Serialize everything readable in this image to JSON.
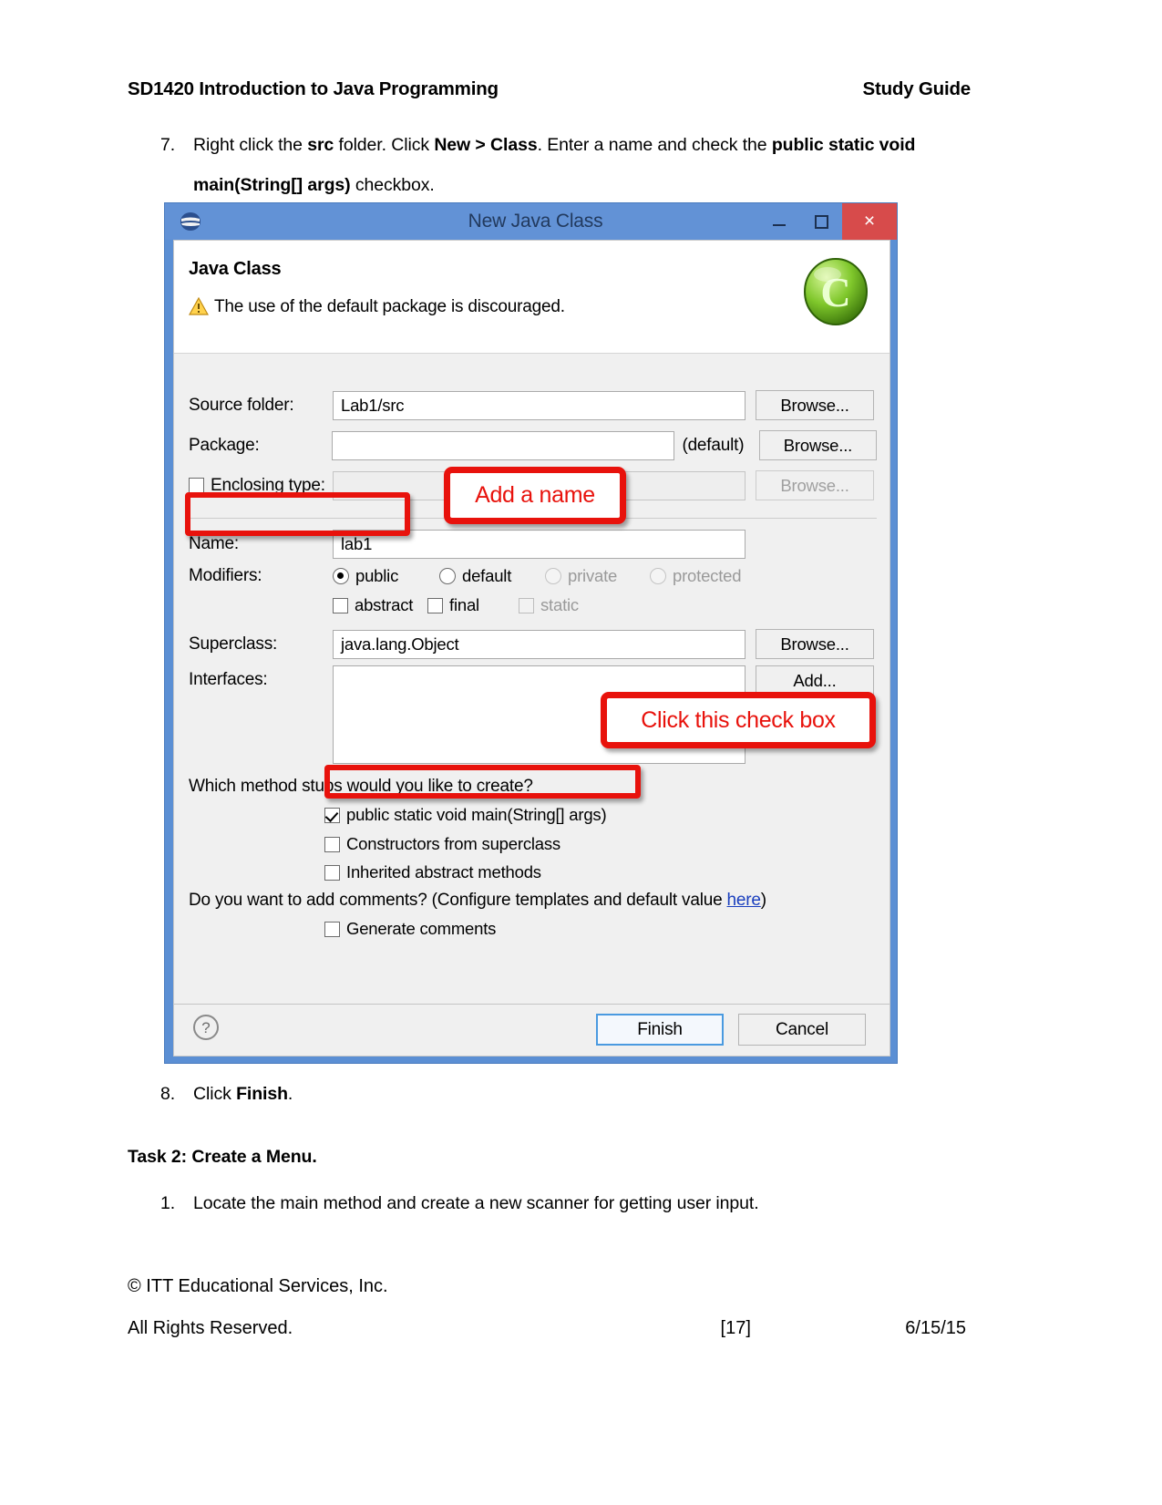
{
  "document": {
    "header_left": "SD1420 Introduction to Java Programming",
    "header_right": "Study Guide",
    "step7": {
      "number": "7.",
      "part1": "Right click the ",
      "bold1": "src",
      "part2": " folder. Click ",
      "bold2": "New > Class",
      "part3": ". Enter a name and check the ",
      "bold3": "public static void main(String[] args)",
      "part4": " checkbox."
    },
    "step8": {
      "number": "8.",
      "part1": "Click ",
      "bold1": "Finish",
      "part2": "."
    },
    "task2_heading": "Task 2: Create a Menu.",
    "task2_step1": {
      "number": "1.",
      "text": "Locate the main method and create a new scanner for getting user input."
    },
    "footer": {
      "copyright": "© ITT Educational Services, Inc.",
      "rights": "All Rights Reserved.",
      "page": "[17]",
      "date": "6/15/15"
    }
  },
  "dialog": {
    "title": "New Java Class",
    "title_icon": "eclipse-icon",
    "window_controls": {
      "minimize": "minimize-icon",
      "maximize": "maximize-icon",
      "close": "×"
    },
    "banner": {
      "heading": "Java Class",
      "message": "The use of the default package is discouraged.",
      "warning_icon": "warning-icon",
      "logo_icon": "java-class-logo-icon"
    },
    "fields": {
      "source_folder_label": "Source folder:",
      "source_folder_value": "Lab1/src",
      "source_folder_browse": "Browse...",
      "package_label": "Package:",
      "package_value": "",
      "package_default_hint": "(default)",
      "package_browse": "Browse...",
      "enclosing_type_label": "Enclosing type:",
      "enclosing_type_value": "",
      "enclosing_type_browse": "Browse...",
      "name_label": "Name:",
      "name_value": "lab1",
      "modifiers_label": "Modifiers:",
      "modifier_public": "public",
      "modifier_default": "default",
      "modifier_private": "private",
      "modifier_protected": "protected",
      "modifier_abstract": "abstract",
      "modifier_final": "final",
      "modifier_static": "static",
      "superclass_label": "Superclass:",
      "superclass_value": "java.lang.Object",
      "superclass_browse": "Browse...",
      "interfaces_label": "Interfaces:",
      "interfaces_add": "Add..."
    },
    "stubs": {
      "question": "Which method stubs would you like to create?",
      "main_method": "public static void main(String[] args)",
      "constructors": "Constructors from superclass",
      "inherited": "Inherited abstract methods"
    },
    "comments": {
      "question_part1": "Do you want to add comments? (Configure templates and default value ",
      "link": "here",
      "question_part2": ")",
      "generate": "Generate comments"
    },
    "footer_buttons": {
      "help_icon": "help-icon",
      "finish": "Finish",
      "cancel": "Cancel"
    }
  },
  "annotations": {
    "add_name": "Add a name",
    "click_checkbox": "Click this check box",
    "color": "#e8120c"
  }
}
